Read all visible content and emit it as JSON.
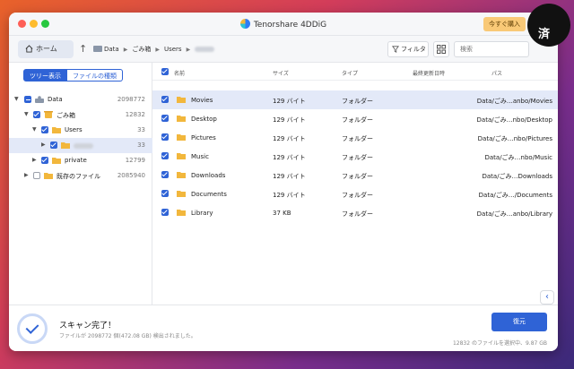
{
  "window": {
    "app_title": "Tenorshare 4DDiG",
    "buy_label": "今すぐ購入"
  },
  "corner_logo": {
    "kanji": "済"
  },
  "toolbar": {
    "home_label": "ホーム",
    "breadcrumb": [
      "Data",
      "ごみ箱",
      "Users"
    ],
    "filter_label": "フィルタ",
    "search_placeholder": "検索"
  },
  "sidebar": {
    "tabs": [
      "ツリー表示",
      "ファイルの種類"
    ],
    "active_tab": "ツリー表示",
    "tree": [
      {
        "label": "Data",
        "count": "2098772"
      },
      {
        "label": "ごみ箱",
        "count": "12832"
      },
      {
        "label": "Users",
        "count": "33"
      },
      {
        "label": "",
        "count": "33"
      },
      {
        "label": "private",
        "count": "12799"
      },
      {
        "label": "既存のファイル",
        "count": "2085940"
      }
    ]
  },
  "list": {
    "columns": [
      "名前",
      "サイズ",
      "タイプ",
      "最終更新日時",
      "パス"
    ],
    "rows": [
      {
        "name": "Movies",
        "size": "129 バイト",
        "type": "フォルダー",
        "path": "Data/ごみ…anbo/Movies"
      },
      {
        "name": "Desktop",
        "size": "129 バイト",
        "type": "フォルダー",
        "path": "Data/ごみ…nbo/Desktop"
      },
      {
        "name": "Pictures",
        "size": "129 バイト",
        "type": "フォルダー",
        "path": "Data/ごみ…nbo/Pictures"
      },
      {
        "name": "Music",
        "size": "129 バイト",
        "type": "フォルダー",
        "path": "Data/ごみ…nbo/Music"
      },
      {
        "name": "Downloads",
        "size": "129 バイト",
        "type": "フォルダー",
        "path": "Data/ごみ…Downloads"
      },
      {
        "name": "Documents",
        "size": "129 バイト",
        "type": "フォルダー",
        "path": "Data/ごみ…/Documents"
      },
      {
        "name": "Library",
        "size": "37 KB",
        "type": "フォルダー",
        "path": "Data/ごみ…anbo/Library"
      }
    ]
  },
  "footer": {
    "scan_title": "スキャン完了！",
    "scan_subtitle": "ファイルが 2098772 個(472.08 GB) 検出されました。",
    "restore_label": "復元",
    "selection_info": "12832 のファイルを選択中、9.87 GB"
  },
  "colors": {
    "accent": "#2f63d6",
    "folder": "#f2b73c",
    "selected_row": "#e3e9f8"
  }
}
